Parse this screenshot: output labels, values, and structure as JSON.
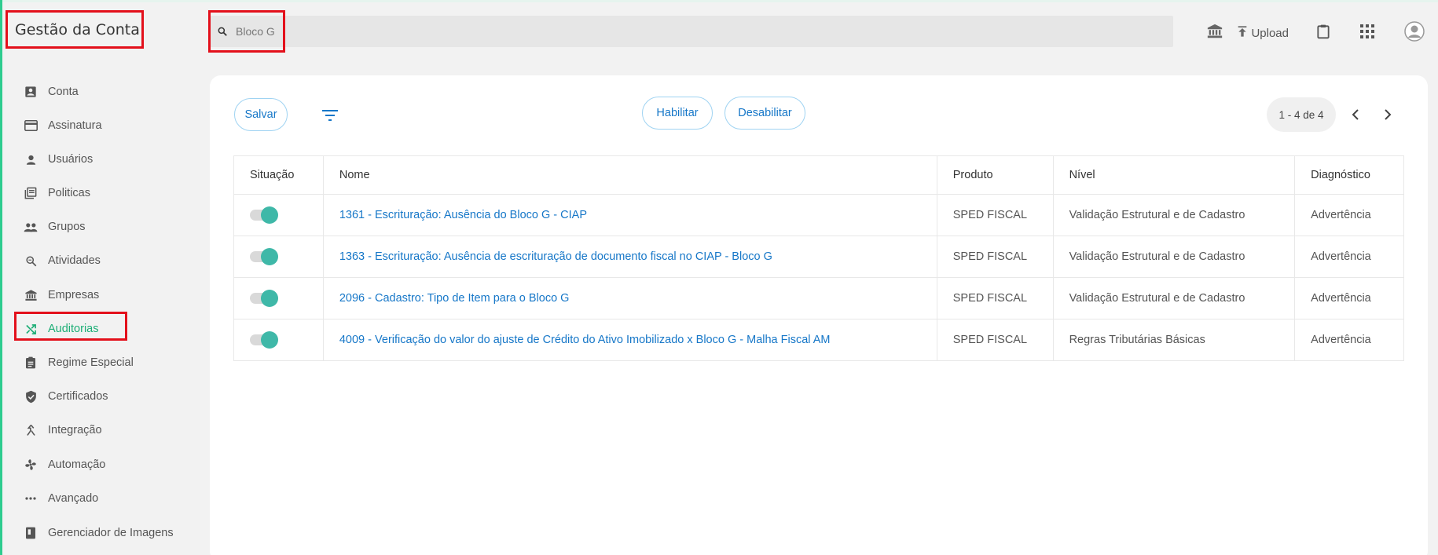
{
  "header": {
    "title": "Gestão da Conta",
    "search": {
      "value": "Bloco G",
      "placeholder": ""
    },
    "actions": {
      "upload_label": "Upload"
    }
  },
  "sidebar": {
    "items": [
      {
        "label": "Conta",
        "icon": "account-box-icon"
      },
      {
        "label": "Assinatura",
        "icon": "credit-card-icon"
      },
      {
        "label": "Usuários",
        "icon": "person-icon"
      },
      {
        "label": "Politicas",
        "icon": "library-books-icon"
      },
      {
        "label": "Grupos",
        "icon": "group-icon"
      },
      {
        "label": "Atividades",
        "icon": "zoom-search-icon"
      },
      {
        "label": "Empresas",
        "icon": "bank-icon"
      },
      {
        "label": "Auditorias",
        "icon": "shuffle-icon",
        "active": true
      },
      {
        "label": "Regime Especial",
        "icon": "clipboard-list-icon"
      },
      {
        "label": "Certificados",
        "icon": "verified-shield-icon"
      },
      {
        "label": "Integração",
        "icon": "merge-icon"
      },
      {
        "label": "Automação",
        "icon": "fan-icon"
      },
      {
        "label": "Avançado",
        "icon": "more-horizontal-icon"
      },
      {
        "label": "Gerenciador de Imagens",
        "icon": "image-book-icon"
      }
    ]
  },
  "toolbar": {
    "save_label": "Salvar",
    "enable_label": "Habilitar",
    "disable_label": "Desabilitar",
    "pagination": "1 - 4 de 4"
  },
  "table": {
    "columns": [
      "Situação",
      "Nome",
      "Produto",
      "Nível",
      "Diagnóstico"
    ],
    "rows": [
      {
        "enabled": true,
        "name": "1361 - Escrituração: Ausência do Bloco G - CIAP",
        "product": "SPED FISCAL",
        "level": "Validação Estrutural e de Cadastro",
        "diagnosis": "Advertência"
      },
      {
        "enabled": true,
        "name": "1363 - Escrituração: Ausência de escrituração de documento fiscal no CIAP - Bloco G",
        "product": "SPED FISCAL",
        "level": "Validação Estrutural e de Cadastro",
        "diagnosis": "Advertência"
      },
      {
        "enabled": true,
        "name": "2096 - Cadastro: Tipo de Item para o Bloco G",
        "product": "SPED FISCAL",
        "level": "Validação Estrutural e de Cadastro",
        "diagnosis": "Advertência"
      },
      {
        "enabled": true,
        "name": "4009 - Verificação do valor do ajuste de Crédito do Ativo Imobilizado x Bloco G - Malha Fiscal AM",
        "product": "SPED FISCAL",
        "level": "Regras Tributárias Básicas",
        "diagnosis": "Advertência"
      }
    ]
  },
  "colors": {
    "accent": "#1dae76",
    "link": "#1677c8",
    "toggle_on": "#3fb8a8",
    "highlight": "#e3101b"
  }
}
